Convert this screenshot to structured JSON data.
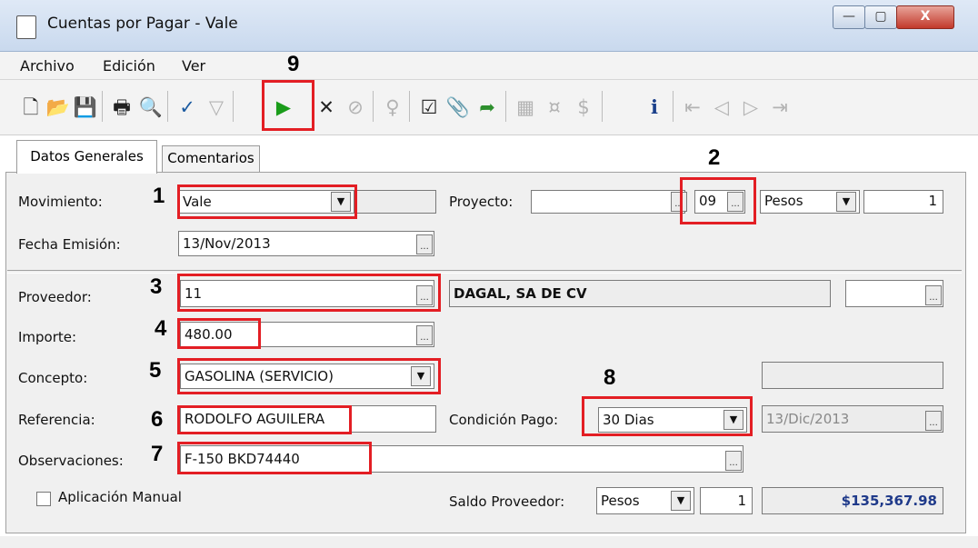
{
  "window": {
    "title": "Cuentas por Pagar - Vale",
    "min": "—",
    "max": "▢",
    "close": "X"
  },
  "menu": {
    "archivo": "Archivo",
    "edicion": "Edición",
    "ver": "Ver"
  },
  "toolbar_icons": [
    "new-document-icon",
    "open-folder-icon",
    "save-icon",
    "print-icon",
    "print-preview-icon",
    "spellcheck-icon",
    "filter-icon",
    "affirm-play-icon",
    "delete-icon",
    "cancel-icon",
    "lightbulb-icon",
    "checklist-icon",
    "attachment-icon",
    "export-icon",
    "calculator-icon",
    "currency-icon",
    "money-icon",
    "info-icon",
    "first-record-icon",
    "previous-record-icon",
    "next-record-icon",
    "last-record-icon"
  ],
  "tabs": {
    "general": "Datos Generales",
    "comentarios": "Comentarios"
  },
  "labels": {
    "movimiento": "Movimiento:",
    "proyecto": "Proyecto:",
    "fecha": "Fecha Emisión:",
    "proveedor": "Proveedor:",
    "importe": "Importe:",
    "concepto": "Concepto:",
    "referencia": "Referencia:",
    "condicion": "Condición Pago:",
    "observaciones": "Observaciones:",
    "aplicacion": "Aplicación Manual",
    "saldo": "Saldo Proveedor:"
  },
  "values": {
    "movimiento": "Vale",
    "proyecto": "",
    "moneda_code": "09",
    "moneda": "Pesos",
    "tipo_cambio": "1",
    "fecha": "13/Nov/2013",
    "proveedor": "11",
    "proveedor_nombre": "DAGAL, SA DE CV",
    "importe": "480.00",
    "concepto": "GASOLINA (SERVICIO)",
    "referencia": "RODOLFO AGUILERA",
    "condicion": "30 Dias",
    "vencimiento": "13/Dic/2013",
    "observaciones": "F-150 BKD74440",
    "saldo_moneda": "Pesos",
    "saldo_tc": "1",
    "saldo": "$135,367.98"
  },
  "annotations": {
    "n1": "1",
    "n2": "2",
    "n3": "3",
    "n4": "4",
    "n5": "5",
    "n6": "6",
    "n7": "7",
    "n8": "8",
    "n9": "9"
  },
  "colors": {
    "annotation_red": "#e31e24",
    "saldo_blue": "#1f3a8a",
    "play_green": "#1a9c1a"
  }
}
